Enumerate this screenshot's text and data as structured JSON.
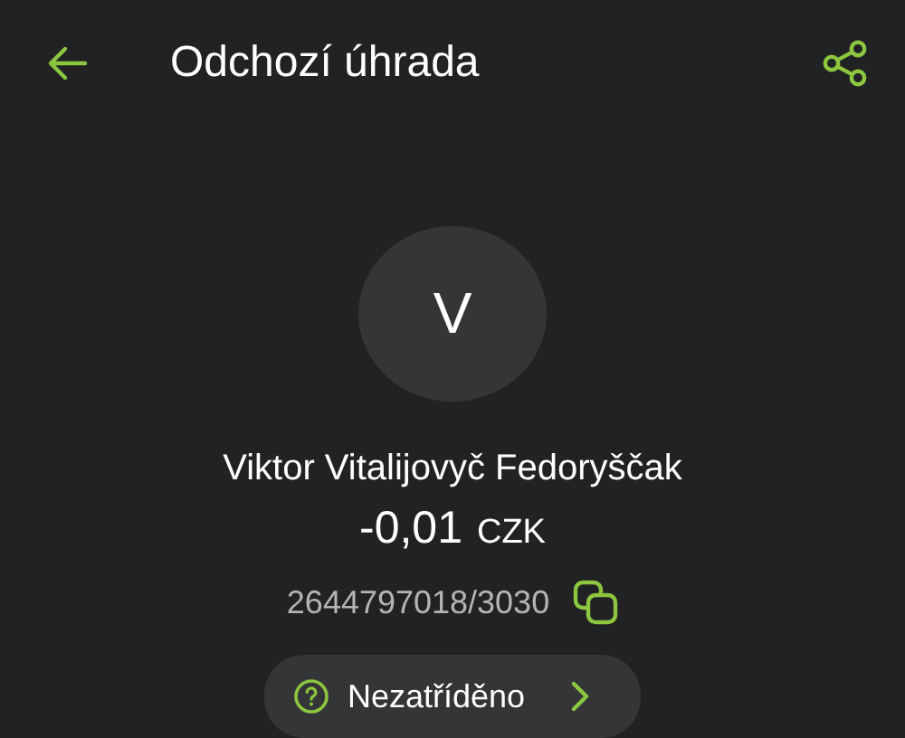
{
  "header": {
    "title": "Odchozí úhrada"
  },
  "avatar": {
    "initial": "V"
  },
  "counterparty": {
    "name": "Viktor Vitalijovyč Fedoryščak",
    "amount": "-0,01",
    "currency": "CZK",
    "account": "2644797018/3030"
  },
  "category": {
    "label": "Nezatříděno"
  }
}
